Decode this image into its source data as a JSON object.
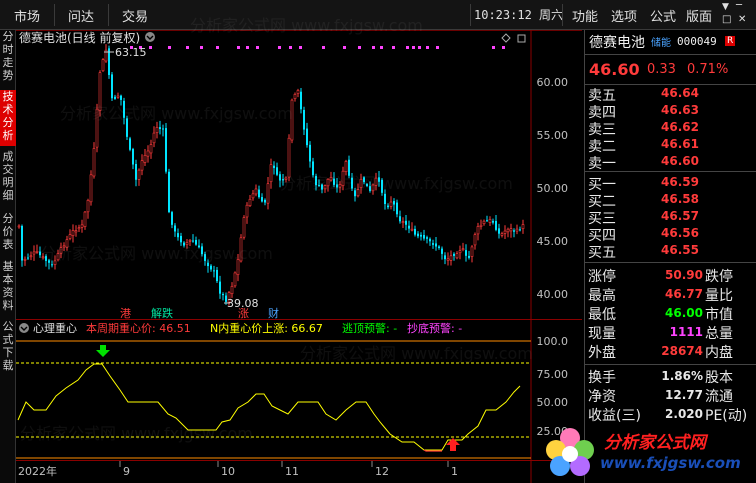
{
  "menu": {
    "left": [
      "市场",
      "问达",
      "交易"
    ],
    "right": [
      "功能",
      "选项",
      "公式",
      "版面"
    ],
    "clock": "10:23:12 周六",
    "window_controls": [
      "▼",
      "─",
      "□",
      "✕"
    ]
  },
  "left_tabs": [
    {
      "label": "分时走势",
      "active": false
    },
    {
      "label": "技术分析",
      "active": true
    },
    {
      "label": "成交明细",
      "active": false
    },
    {
      "label": "分价表",
      "active": false
    },
    {
      "label": "基本资料",
      "active": false
    },
    {
      "label": "公式下载",
      "active": false
    }
  ],
  "chart": {
    "title": "德赛电池(日线 前复权)",
    "price_axis": [
      "60.00",
      "55.00",
      "50.00",
      "45.00",
      "40.00"
    ],
    "high_label": "63.15",
    "low_label": "39.08",
    "markers": [
      "港",
      "解跌",
      "涨",
      "财"
    ],
    "indicator_name": "心理重心",
    "indicator_line1": "本周期重心价: 46.51",
    "indicator_line2": "N内重心价上涨: 66.67",
    "indicator_line3": "逃顶预警: -",
    "indicator_line4": "抄底预警: -",
    "indicator_axis": [
      "100.0",
      "75.00",
      "50.00",
      "25.00"
    ],
    "x_axis": [
      "2022年",
      "9",
      "10",
      "11",
      "12",
      "1"
    ],
    "colors": {
      "up": "#ff3b3b",
      "down": "#00e5ff",
      "indicator": "#ffff00",
      "level": "#ff8c00"
    }
  },
  "quote": {
    "name": "德赛电池",
    "tag": "储能",
    "code": "000049",
    "badge": "R",
    "price": "46.60",
    "change": "0.33",
    "pct": "0.71%",
    "asks": [
      {
        "label": "卖五",
        "price": "46.64"
      },
      {
        "label": "卖四",
        "price": "46.63"
      },
      {
        "label": "卖三",
        "price": "46.62"
      },
      {
        "label": "卖二",
        "price": "46.61"
      },
      {
        "label": "卖一",
        "price": "46.60"
      }
    ],
    "bids": [
      {
        "label": "买一",
        "price": "46.59"
      },
      {
        "label": "买二",
        "price": "46.58"
      },
      {
        "label": "买三",
        "price": "46.57"
      },
      {
        "label": "买四",
        "price": "46.56"
      },
      {
        "label": "买五",
        "price": "46.55"
      }
    ],
    "stats": [
      {
        "label": "涨停",
        "value": "50.90",
        "label2": "跌停",
        "color": "#ff3b3b"
      },
      {
        "label": "最高",
        "value": "46.77",
        "label2": "量比",
        "color": "#ff3b3b"
      },
      {
        "label": "最低",
        "value": "46.00",
        "label2": "市值",
        "color": "#00ff00"
      },
      {
        "label": "现量",
        "value": "1111",
        "label2": "总量",
        "color": "#ff44ff"
      },
      {
        "label": "外盘",
        "value": "28674",
        "label2": "内盘",
        "color": "#ff3b3b"
      },
      {
        "label": "换手",
        "value": "1.86%",
        "label2": "股本",
        "color": "#e8e8e8"
      },
      {
        "label": "净资",
        "value": "12.77",
        "label2": "流通",
        "color": "#e8e8e8"
      },
      {
        "label": "收益(三)",
        "value": "2.020",
        "label2": "PE(动)",
        "color": "#e8e8e8"
      }
    ]
  },
  "logo": {
    "text": "分析家公式网",
    "url": "www.fxjgsw.com"
  },
  "watermark": "分析家公式网 www.fxjgsw.com"
}
